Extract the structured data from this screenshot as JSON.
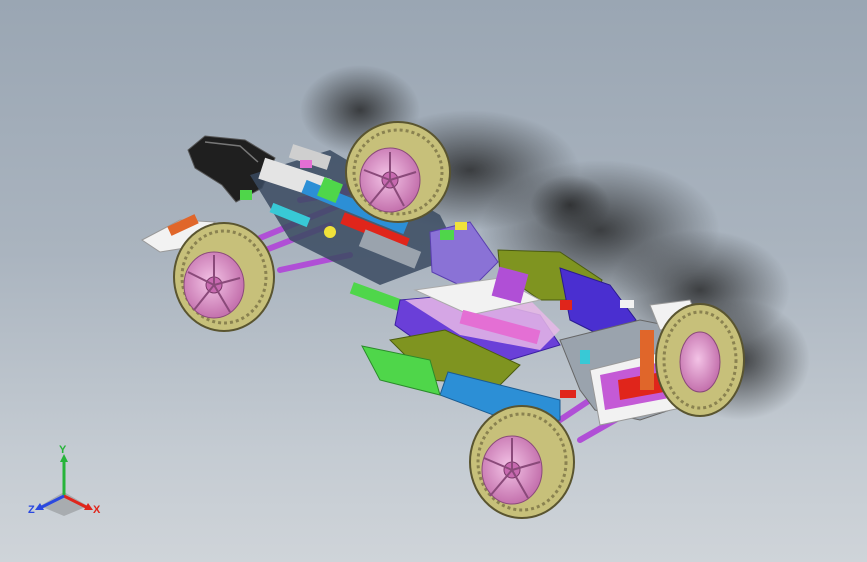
{
  "viewport": {
    "description_colors": {
      "background_top": "#9aa6b3",
      "background_bottom": "#cfd4d9",
      "tire": "#c7c07a",
      "rim": "#d98fc6",
      "suspension": "#b04fd6",
      "body_purple": "#5a2fd0",
      "body_olive": "#7f9420",
      "body_blue": "#2c8fd6",
      "body_green": "#4fd64a"
    }
  },
  "triad": {
    "x_label": "X",
    "y_label": "Y",
    "z_label": "Z",
    "x_color": "#e0251b",
    "y_color": "#27b43a",
    "z_color": "#2a48e0"
  }
}
